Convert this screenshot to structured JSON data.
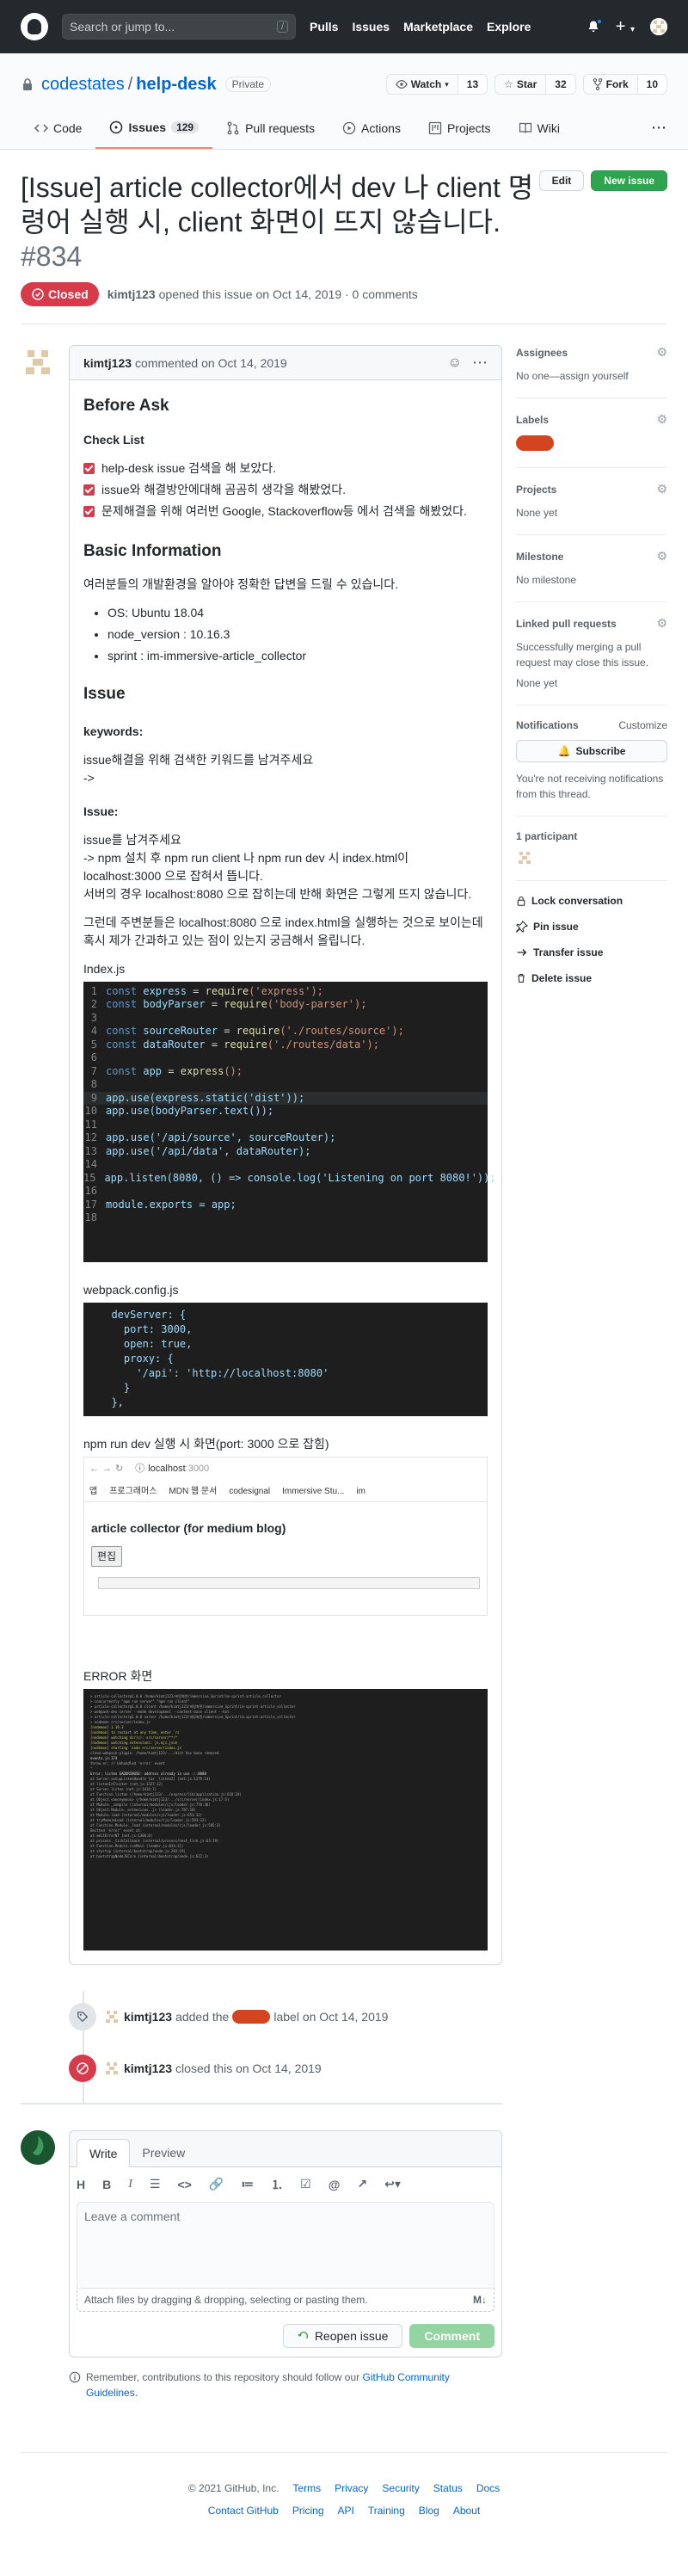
{
  "header": {
    "search_placeholder": "Search or jump to...",
    "search_key": "/",
    "nav": [
      "Pulls",
      "Issues",
      "Marketplace",
      "Explore"
    ]
  },
  "repo": {
    "owner": "codestates",
    "name": "help-desk",
    "visibility": "Private",
    "watch_label": "Watch",
    "watch_count": "13",
    "star_label": "Star",
    "star_count": "32",
    "fork_label": "Fork",
    "fork_count": "10",
    "tabs": [
      {
        "label": "Code"
      },
      {
        "label": "Issues",
        "count": "129"
      },
      {
        "label": "Pull requests"
      },
      {
        "label": "Actions"
      },
      {
        "label": "Projects"
      },
      {
        "label": "Wiki"
      }
    ]
  },
  "issue": {
    "title": "[Issue] article collector에서 dev 나 client 명령어 실행 시, client 화면이 뜨지 않습니다.",
    "number": "#834",
    "edit_label": "Edit",
    "new_label": "New issue",
    "state": "Closed",
    "author": "kimtj123",
    "opened_text": "opened this issue on Oct 14, 2019 · 0 comments"
  },
  "comment": {
    "author": "kimtj123",
    "meta": "commented on Oct 14, 2019",
    "before_ask": "Before Ask",
    "checklist_title": "Check List",
    "checklist": [
      "help-desk issue 검색을 해 보았다.",
      "issue와 해결방안에대해 곰곰히 생각을 해봤었다.",
      "문제해결을 위해 여러번 Google, Stackoverflow등 에서 검색을 해봤었다."
    ],
    "basic_title": "Basic Information",
    "basic_intro": "여러분들의 개발환경을 알아야 정확한 답변을 드릴 수 있습니다.",
    "basic_items": [
      "OS: Ubuntu 18.04",
      "node_version : 10.16.3",
      "sprint : im-immersive-article_collector"
    ],
    "issue_title": "Issue",
    "keywords_title": "keywords:",
    "keywords_text": "issue해결을 위해 검색한 키워드를 남겨주세요",
    "keywords_arrow": "->",
    "issue_sub": "Issue:",
    "issue_p1": "issue를 남겨주세요",
    "issue_p2": "-> npm 설치 후 npm run client 나 npm run dev 시 index.html이 localhost:3000 으로 잡혀서 뜹니다.",
    "issue_p3": "서버의 경우 localhost:8080 으로 잡히는데 반해 화면은 그렇게 뜨지 않습니다.",
    "issue_p4": "그런데 주변분들은 localhost:8080 으로 index.html을 실행하는 것으로 보이는데 혹시 제가 간과하고 있는 점이 있는지 궁금해서 올립니다.",
    "index_caption": "Index.js",
    "webpack_caption": "webpack.config.js",
    "npm_caption": "npm run dev 실행 시 화면(port: 3000 으로 잡힘)",
    "error_caption": "ERROR 화면"
  },
  "index_code": [
    {
      "k": "const",
      "v": "express",
      "e": " = ",
      "f": "require",
      "s": "('express');"
    },
    {
      "k": "const",
      "v": "bodyParser",
      "e": " = ",
      "f": "require",
      "s": "('body-parser');"
    },
    {
      "blank": true
    },
    {
      "k": "const",
      "v": "sourceRouter",
      "e": " = ",
      "f": "require",
      "s": "('./routes/source');"
    },
    {
      "k": "const",
      "v": "dataRouter",
      "e": " = ",
      "f": "require",
      "s": "('./routes/data');"
    },
    {
      "blank": true
    },
    {
      "k": "const",
      "v": "app",
      "e": " = ",
      "f": "express",
      "s": "();"
    },
    {
      "blank": true
    },
    {
      "raw": "app.use(express.static('dist'));",
      "hl": true
    },
    {
      "raw": "app.use(bodyParser.text());"
    },
    {
      "blank": true
    },
    {
      "raw": "app.use('/api/source', sourceRouter);"
    },
    {
      "raw": "app.use('/api/data', dataRouter);"
    },
    {
      "blank": true
    },
    {
      "raw": "app.listen(8080, () => console.log('Listening on port 8080!'));"
    },
    {
      "blank": true
    },
    {
      "raw": "module.exports = app;"
    },
    {
      "blank": true
    }
  ],
  "webpack_code": [
    "  devServer: {",
    "    port: 3000,",
    "    open: true,",
    "    proxy: {",
    "      '/api': 'http://localhost:8080'",
    "    }",
    "  },"
  ],
  "browser": {
    "address_host": "localhost",
    "address_port": ":3000",
    "bookmarks": [
      "앱",
      "프로그래머스",
      "MDN 웹 문서",
      "codesignal",
      "Immersive Stu...",
      "im"
    ],
    "heading": "article collector (for medium blog)",
    "edit_btn": "편집"
  },
  "terminal": [
    "> article-collector@1.0.0 /home/kimtj123/바탕화면/immersive_Sprint/im-sprint-article_collector",
    "> concurrently \"npm run server\" \"npm run client\"",
    "",
    "> article-collector@1.0.0 client /home/kimtj123/바탕화면/immersive_Sprint/im-sprint-article_collector",
    "> webpack-dev-server --mode development --content-base client --hot",
    "",
    "> article-collector@1.0.0 server /home/kimtj123/바탕화면/immersive_Sprint/im-sprint-article_collector",
    "> nodemon src/server/index.js",
    "",
    "[nodemon] 1.19.3",
    "[nodemon] to restart at any time, enter `rs`",
    "[nodemon] watching dir(s): src/server/**/*",
    "[nodemon] watching extensions: js,mjs,json",
    "[nodemon] starting `node src/server/index.js`",
    "clean-webpack-plugin: /home/kimtj123/.../dist has been removed.",
    "events.js:174",
    "      throw er; // Unhandled 'error' event",
    "      ^",
    "",
    "Error: listen EADDRINUSE: address already in use :::8080",
    "    at Server.setupListenHandle [as _listen2] (net.js:1279:14)",
    "    at listenInCluster (net.js:1327:12)",
    "    at Server.listen (net.js:1414:7)",
    "    at Function.listen (/home/kimtj123/.../express/lib/application.js:618:24)",
    "    at Object.<anonymous> (/home/kimtj123/.../src/server/index.js:17:5)",
    "    at Module._compile (internal/modules/cjs/loader.js:776:30)",
    "    at Object.Module._extensions..js (loader.js:787:10)",
    "    at Module.load (internal/modules/cjs/loader.js:653:32)",
    "    at tryModuleLoad (internal/modules/cjs/loader.js:593:12)",
    "    at Function.Module._load (internal/modules/cjs/loader.js:585:3)",
    "Emitted 'error' event at:",
    "    at emitErrorNT (net.js:1306:8)",
    "    at process._tickCallback (internal/process/next_tick.js:63:19)",
    "    at Function.Module.runMain (loader.js:834:11)",
    "    at startup (internal/bootstrap/node.js:283:19)",
    "    at bootstrapNodeJSCore (internal/bootstrap/node.js:622:3)"
  ],
  "sidebar": {
    "assignees_title": "Assignees",
    "assignees_text": "No one—assign yourself",
    "labels_title": "Labels",
    "projects_title": "Projects",
    "projects_text": "None yet",
    "milestone_title": "Milestone",
    "milestone_text": "No milestone",
    "linked_title": "Linked pull requests",
    "linked_text": "Successfully merging a pull request may close this issue.",
    "linked_none": "None yet",
    "notif_title": "Notifications",
    "notif_customize": "Customize",
    "subscribe": "Subscribe",
    "notif_text": "You're not receiving notifications from this thread.",
    "participants": "1 participant",
    "lock": "Lock conversation",
    "pin": "Pin issue",
    "transfer": "Transfer issue",
    "delete": "Delete issue"
  },
  "timeline": {
    "label_author": "kimtj123",
    "label_pre": "added the",
    "label_post": "label on Oct 14, 2019",
    "closed_author": "kimtj123",
    "closed_text": "closed this on Oct 14, 2019"
  },
  "composer": {
    "tab_write": "Write",
    "tab_preview": "Preview",
    "placeholder": "Leave a comment",
    "attach": "Attach files by dragging & dropping, selecting or pasting them.",
    "reopen": "Reopen issue",
    "comment": "Comment",
    "remember": "Remember, contributions to this repository should follow our",
    "guidelines": "GitHub Community Guidelines."
  },
  "footer": {
    "copyright": "© 2021 GitHub, Inc.",
    "row1": [
      "Terms",
      "Privacy",
      "Security",
      "Status",
      "Docs"
    ],
    "row2": [
      "Contact GitHub",
      "Pricing",
      "API",
      "Training",
      "Blog",
      "About"
    ]
  }
}
